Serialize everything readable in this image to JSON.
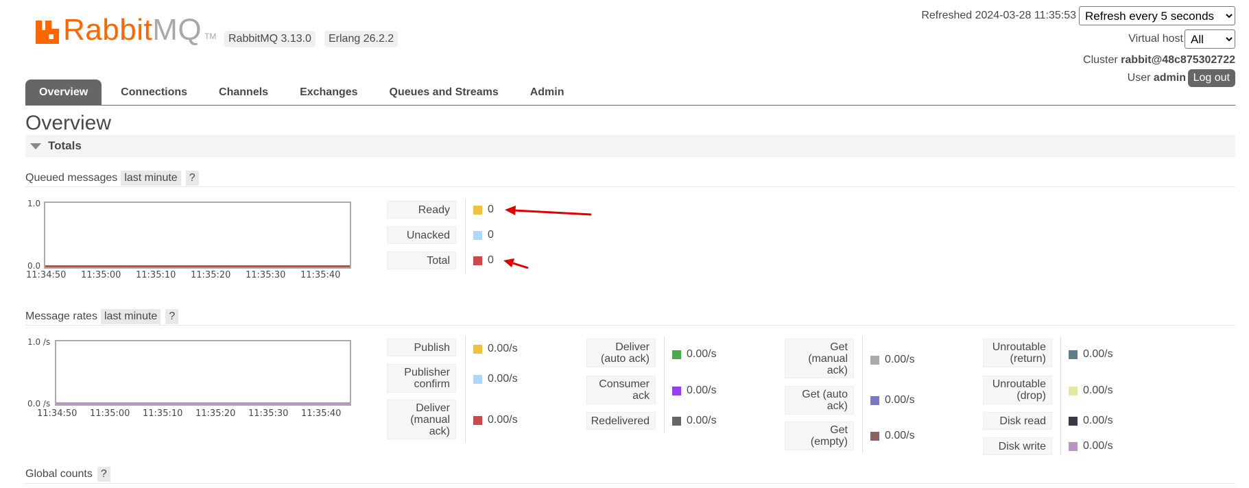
{
  "header": {
    "brand_primary": "Rabbit",
    "brand_secondary": "MQ",
    "trademark": "TM",
    "versions": [
      "RabbitMQ 3.13.0",
      "Erlang 26.2.2"
    ],
    "refreshed_label": "Refreshed 2024-03-28 11:35:53",
    "refresh_select": "Refresh every 5 seconds",
    "vhost_label": "Virtual host",
    "vhost_select": "All",
    "cluster_label": "Cluster",
    "cluster_name": "rabbit@48c875302722",
    "user_label": "User",
    "user_name": "admin",
    "logout_label": "Log out"
  },
  "tabs": [
    {
      "label": "Overview",
      "active": true
    },
    {
      "label": "Connections",
      "active": false
    },
    {
      "label": "Channels",
      "active": false
    },
    {
      "label": "Exchanges",
      "active": false
    },
    {
      "label": "Queues and Streams",
      "active": false
    },
    {
      "label": "Admin",
      "active": false
    }
  ],
  "page_title": "Overview",
  "totals": {
    "section_label": "Totals",
    "queued": {
      "label": "Queued messages",
      "range": "last minute",
      "help": "?",
      "graph": {
        "y_top": "1.0",
        "y_bottom": "0.0",
        "x_ticks": [
          "11:34:50",
          "11:35:00",
          "11:35:10",
          "11:35:20",
          "11:35:30",
          "11:35:40"
        ]
      },
      "legend": [
        {
          "label": "Ready",
          "value": "0",
          "color": "#edc240"
        },
        {
          "label": "Unacked",
          "value": "0",
          "color": "#afd8f8"
        },
        {
          "label": "Total",
          "value": "0",
          "color": "#cb4b4b"
        }
      ]
    },
    "rates": {
      "label": "Message rates",
      "range": "last minute",
      "help": "?",
      "graph": {
        "y_top": "1.0 /s",
        "y_bottom": "0.0 /s",
        "x_ticks": [
          "11:34:50",
          "11:35:00",
          "11:35:10",
          "11:35:20",
          "11:35:30",
          "11:35:40"
        ]
      },
      "col1": [
        {
          "label": "Publish",
          "value": "0.00/s",
          "color": "#edc240"
        },
        {
          "label": "Publisher confirm",
          "value": "0.00/s",
          "color": "#afd8f8"
        },
        {
          "label": "Deliver (manual ack)",
          "value": "0.00/s",
          "color": "#cb4b4b"
        }
      ],
      "col2": [
        {
          "label": "Deliver (auto ack)",
          "value": "0.00/s",
          "color": "#4da74d"
        },
        {
          "label": "Consumer ack",
          "value": "0.00/s",
          "color": "#9440ed"
        },
        {
          "label": "Redelivered",
          "value": "0.00/s",
          "color": "#666666"
        }
      ],
      "col3": [
        {
          "label": "Get (manual ack)",
          "value": "0.00/s",
          "color": "#aaaaaa"
        },
        {
          "label": "Get (auto ack)",
          "value": "0.00/s",
          "color": "#7c79c3"
        },
        {
          "label": "Get (empty)",
          "value": "0.00/s",
          "color": "#8d6260"
        }
      ],
      "col4": [
        {
          "label": "Unroutable (return)",
          "value": "0.00/s",
          "color": "#617c87"
        },
        {
          "label": "Unroutable (drop)",
          "value": "0.00/s",
          "color": "#e6e6a6"
        },
        {
          "label": "Disk read",
          "value": "0.00/s",
          "color": "#3a3a46"
        },
        {
          "label": "Disk write",
          "value": "0.00/s",
          "color": "#b994c4"
        }
      ]
    },
    "global": {
      "label": "Global counts",
      "help": "?"
    }
  }
}
